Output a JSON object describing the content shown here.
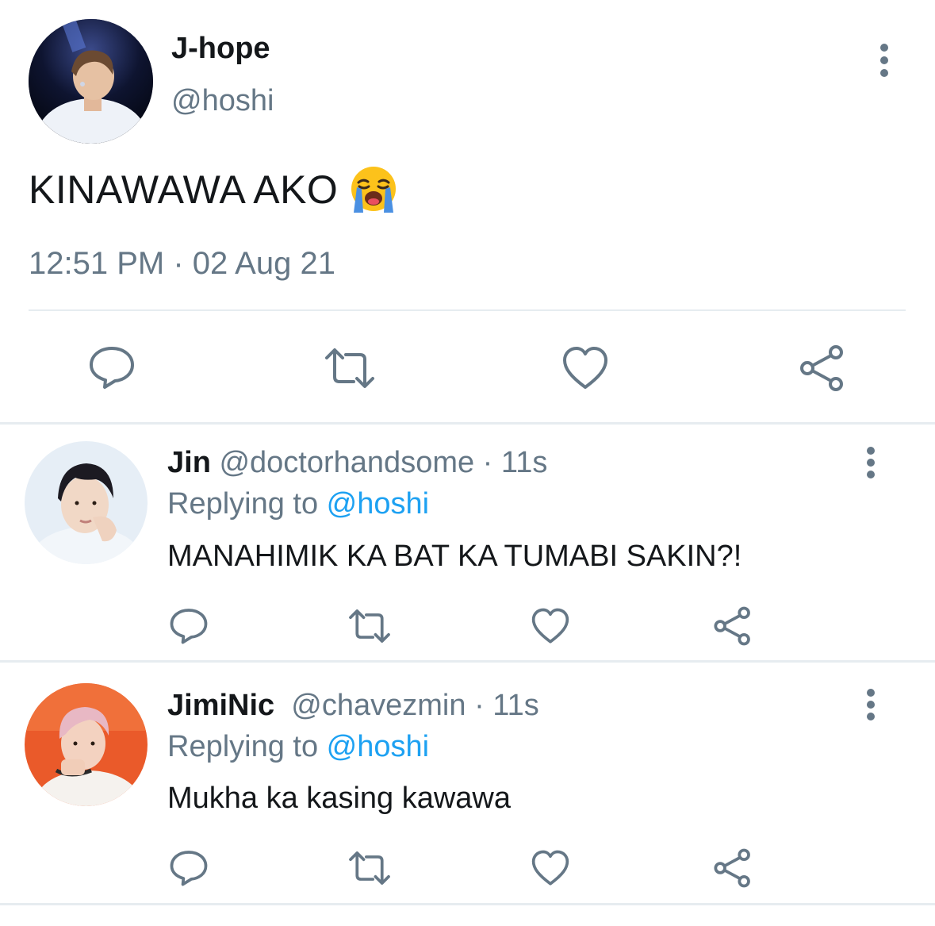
{
  "main_tweet": {
    "name": "J-hope",
    "handle": "@hoshi",
    "text": "KINAWAWA AKO",
    "emoji": "loudly-crying-face",
    "timestamp": "12:51 PM · 02 Aug 21"
  },
  "replies": [
    {
      "name": "Jin",
      "handle": "@doctorhandsome",
      "separator": " · ",
      "time": "11s",
      "replying_prefix": "Replying to ",
      "replying_to": "@hoshi",
      "text": "MANAHIMIK KA BAT KA TUMABI SAKIN?!"
    },
    {
      "name": "JimiNic",
      "handle": "@chavezmin",
      "separator": " · ",
      "time": "11s",
      "replying_prefix": "Replying to ",
      "replying_to": "@hoshi",
      "text": "Mukha ka kasing kawawa"
    }
  ],
  "icons": {
    "reply": "reply-icon",
    "retweet": "retweet-icon",
    "like": "heart-icon",
    "share": "share-icon",
    "more": "more-options-icon"
  },
  "colors": {
    "text": "#14171a",
    "secondary": "#657786",
    "link": "#1da1f2",
    "divider": "#e6ecf0"
  }
}
